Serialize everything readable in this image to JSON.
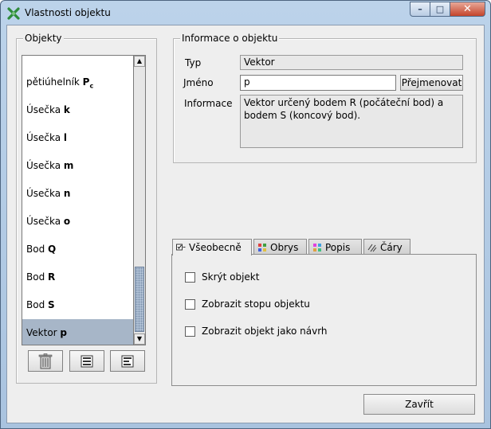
{
  "window": {
    "title": "Vlastnosti objektu",
    "minimize": "–",
    "maximize": "□",
    "close": "✕"
  },
  "objects_panel": {
    "legend": "Objekty",
    "items": [
      {
        "prefix": "pětiúhelník ",
        "name": "P",
        "sub": "c",
        "selected": false
      },
      {
        "prefix": "Úsečka ",
        "name": "k",
        "selected": false
      },
      {
        "prefix": "Úsečka ",
        "name": "l",
        "selected": false
      },
      {
        "prefix": "Úsečka ",
        "name": "m",
        "selected": false
      },
      {
        "prefix": "Úsečka ",
        "name": "n",
        "selected": false
      },
      {
        "prefix": "Úsečka ",
        "name": "o",
        "selected": false
      },
      {
        "prefix": "Bod ",
        "name": "Q",
        "selected": false
      },
      {
        "prefix": "Bod ",
        "name": "R",
        "selected": false
      },
      {
        "prefix": "Bod ",
        "name": "S",
        "selected": false
      },
      {
        "prefix": "Vektor ",
        "name": "p",
        "selected": true
      }
    ],
    "buttons": {
      "delete_icon": "trash-icon",
      "list_icon_1": "list-icon",
      "list_icon_2": "list-detail-icon"
    }
  },
  "info_panel": {
    "legend": "Informace o objektu",
    "type_label": "Typ",
    "type_value": "Vektor",
    "name_label": "Jméno",
    "name_value": "p",
    "rename_button": "Přejmenovat",
    "info_label": "Informace",
    "info_value": "Vektor určený bodem R (počáteční bod) a bodem S (koncový bod)."
  },
  "tabs": [
    {
      "label": "Všeobecně",
      "icon": "general-icon",
      "active": true
    },
    {
      "label": "Obrys",
      "icon": "outline-icon",
      "active": false
    },
    {
      "label": "Popis",
      "icon": "label-icon",
      "active": false
    },
    {
      "label": "Čáry",
      "icon": "lines-icon",
      "active": false
    }
  ],
  "general_tab": {
    "checkboxes": [
      {
        "label": "Skrýt objekt",
        "checked": false
      },
      {
        "label": "Zobrazit stopu objektu",
        "checked": false
      },
      {
        "label": "Zobrazit objekt jako návrh",
        "checked": false
      }
    ]
  },
  "close_button": "Zavřít",
  "colors": {
    "selection": "#a7b6c8",
    "title_gradient": "#bcd3ea",
    "close_red": "#c4442b"
  }
}
